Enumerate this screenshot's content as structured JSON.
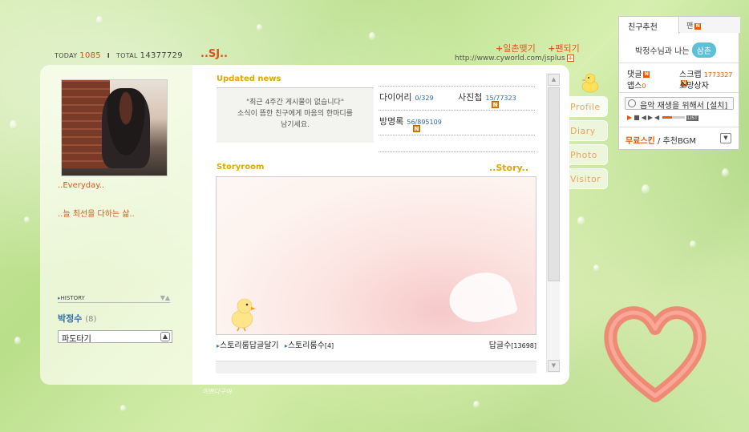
{
  "counter": {
    "today_label": "TODAY",
    "today_value": "1085",
    "separator": "I",
    "total_label": "TOTAL",
    "total_value": "14377729"
  },
  "site_title": "..SJ..",
  "top_links": {
    "ilchon": "일촌맺기",
    "fan": "팬되기"
  },
  "url": "http://www.cyworld.com/jsplus",
  "profile": {
    "everyday": "..Everyday..",
    "slogan": "..늘 최선을 다하는 삶.."
  },
  "history": {
    "label": "HISTORY",
    "owner_name": "박정수",
    "owner_count": "(8)",
    "surf_select": "파도타기"
  },
  "updated": {
    "title": "Updated news",
    "line1": "\"최근 4주간 게시물이 없습니다\"",
    "line2": "소식이 뜸한 친구에게 마음의 한마디를",
    "line3": "남기세요."
  },
  "stats": {
    "diary_label": "다이어리",
    "diary_value": "0/329",
    "photo_label": "사진첩",
    "photo_value": "15/77323",
    "guest_label": "방명록",
    "guest_value": "56/895109",
    "new_badge": "N"
  },
  "storyroom": {
    "title": "Storyroom",
    "link": "..Story..",
    "reply_label": "스토리룸답글달기",
    "count_label": "스토리룸수",
    "count_value": "[4]",
    "reply_count_label": "답글수",
    "reply_count_value": "[13698]"
  },
  "side_tabs": [
    "Profile",
    "Diary",
    "Photo",
    "Visitor"
  ],
  "widget": {
    "tab_friends": "친구추천",
    "tab_fan": "팬",
    "chon_text": "박정수님과 나는",
    "chon_badge": "삼촌",
    "comment_label": "댓글",
    "scrap_label": "스크랩",
    "scrap_value": "1773327",
    "apps_label": "앱스",
    "apps_value": "0",
    "owner_label": "소망상자",
    "player_text": "음악 재생을 위해서 [설치]",
    "list_label": "LIST",
    "skin_bold": "무료스킨",
    "skin_rest": "/ 추천BGM"
  },
  "signature": "이쁘다구여",
  "colors": {
    "accent": "#e85a00",
    "title_gold": "#e2a700",
    "link_blue": "#2e6aa8",
    "bg_green": "#b9df8a"
  },
  "icons": [
    "plus-icon",
    "new-badge-icon",
    "triangle-bullet-icon",
    "chevron-down-icon",
    "disc-icon",
    "play-icon",
    "stop-icon",
    "prev-icon",
    "next-icon",
    "volume-icon",
    "scroll-up-icon",
    "scroll-down-icon",
    "duck-icon",
    "heart-icon"
  ]
}
